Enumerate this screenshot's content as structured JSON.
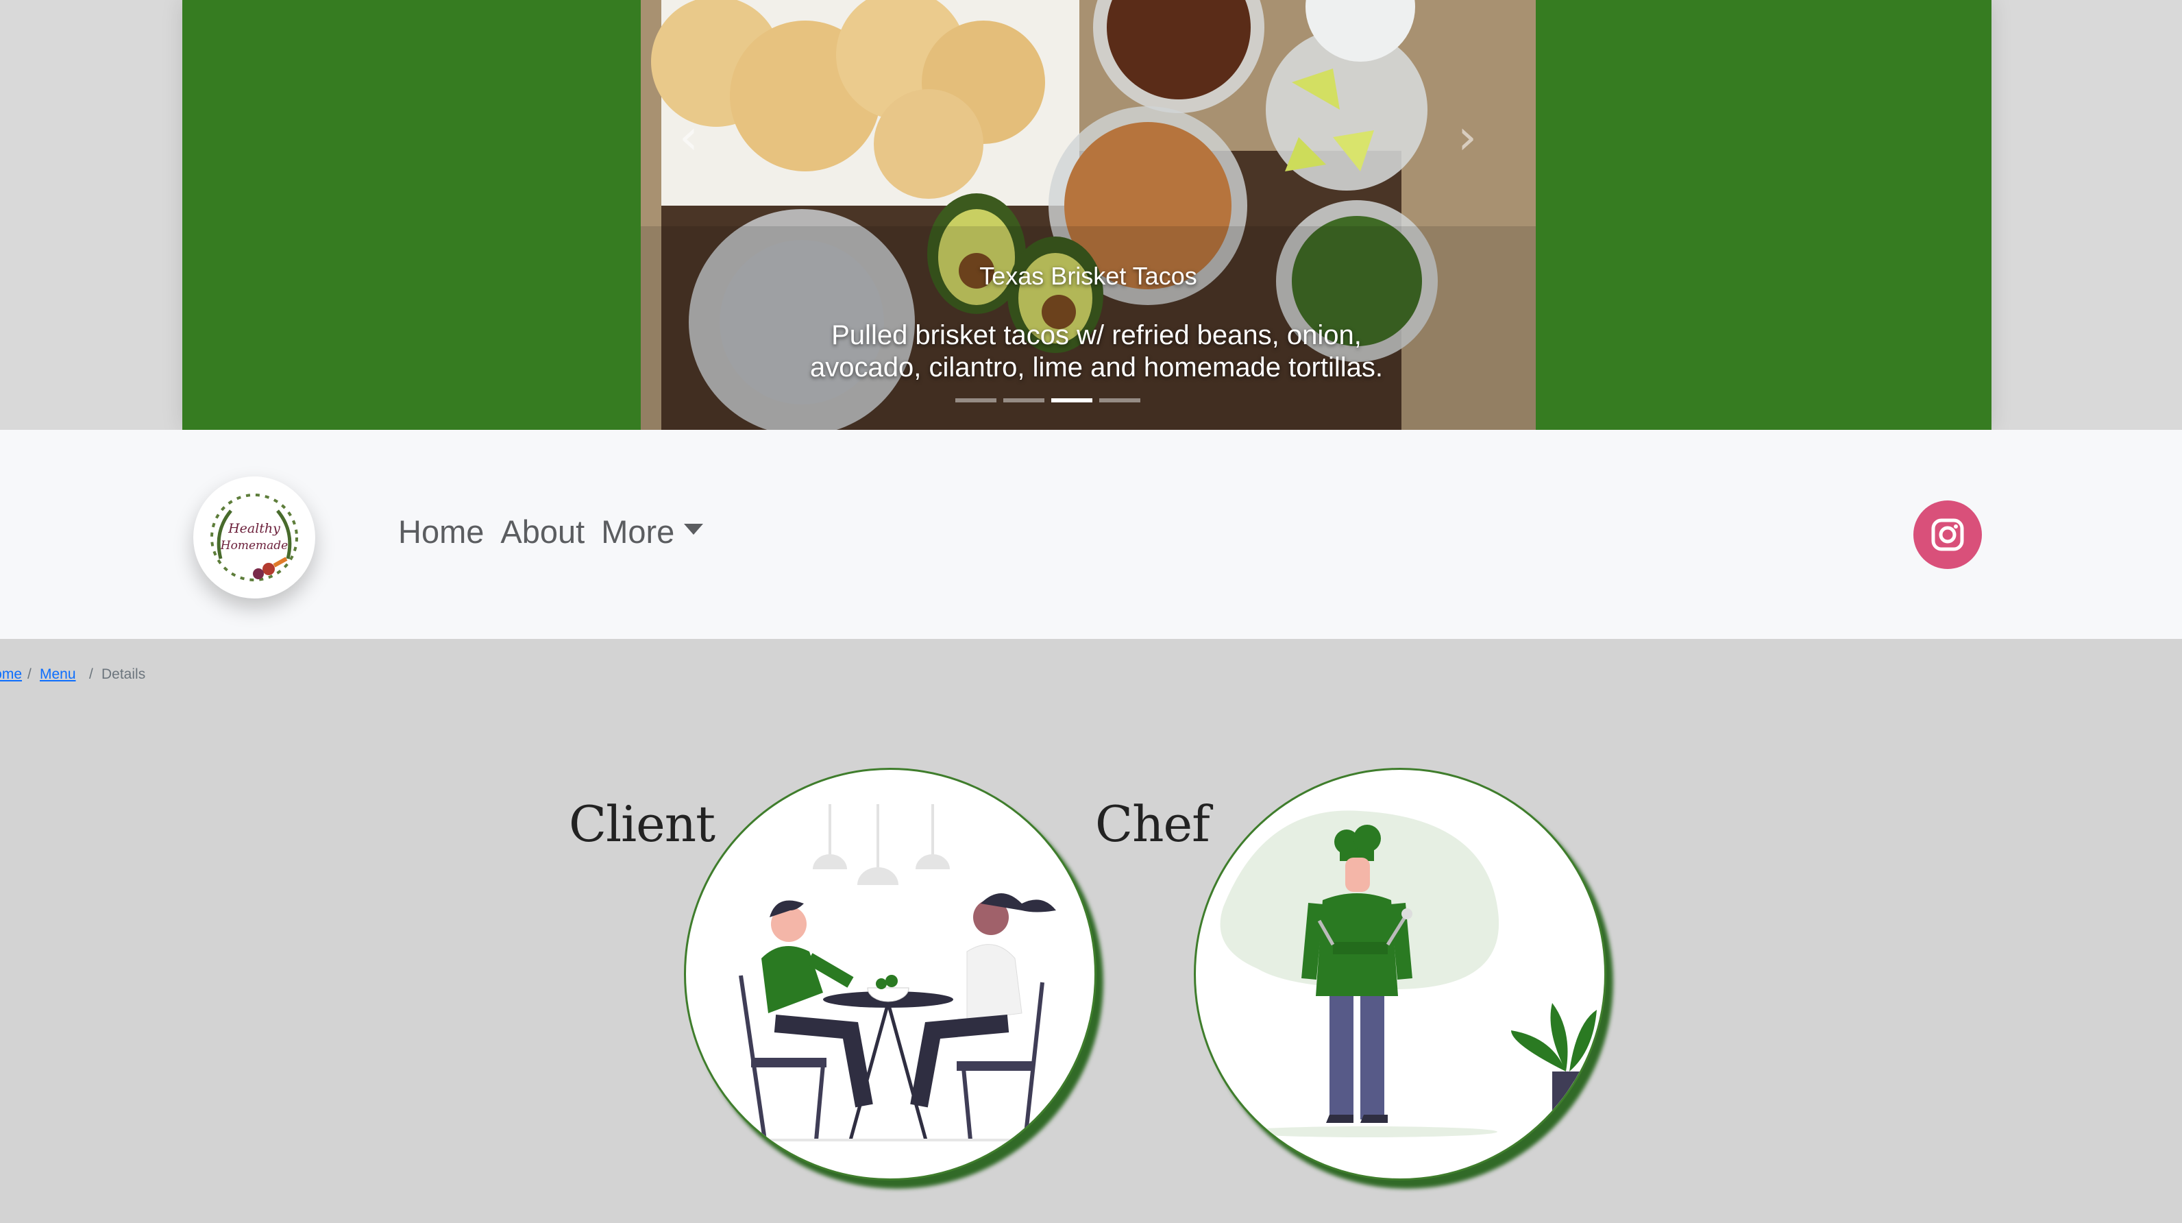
{
  "carousel": {
    "slide_title": "Texas Brisket Tacos",
    "slide_caption": "Pulled brisket tacos w/ refried beans, onion, avocado, cilantro, lime and homemade tortillas.",
    "prev_icon": "chevron-left-icon",
    "next_icon": "chevron-right-icon",
    "indicator_count": 4,
    "active_indicator": 2,
    "band_color": "#367c21"
  },
  "navbar": {
    "logo_text": "Healthy Homemade",
    "links": [
      "Home",
      "About",
      "More"
    ],
    "social_icon": "instagram-icon",
    "social_color": "#d9507a"
  },
  "breadcrumb": {
    "items": [
      "Home",
      "Menu",
      "Details"
    ],
    "separator": "/"
  },
  "roles": {
    "client_label": "Client",
    "chef_label": "Chef"
  }
}
